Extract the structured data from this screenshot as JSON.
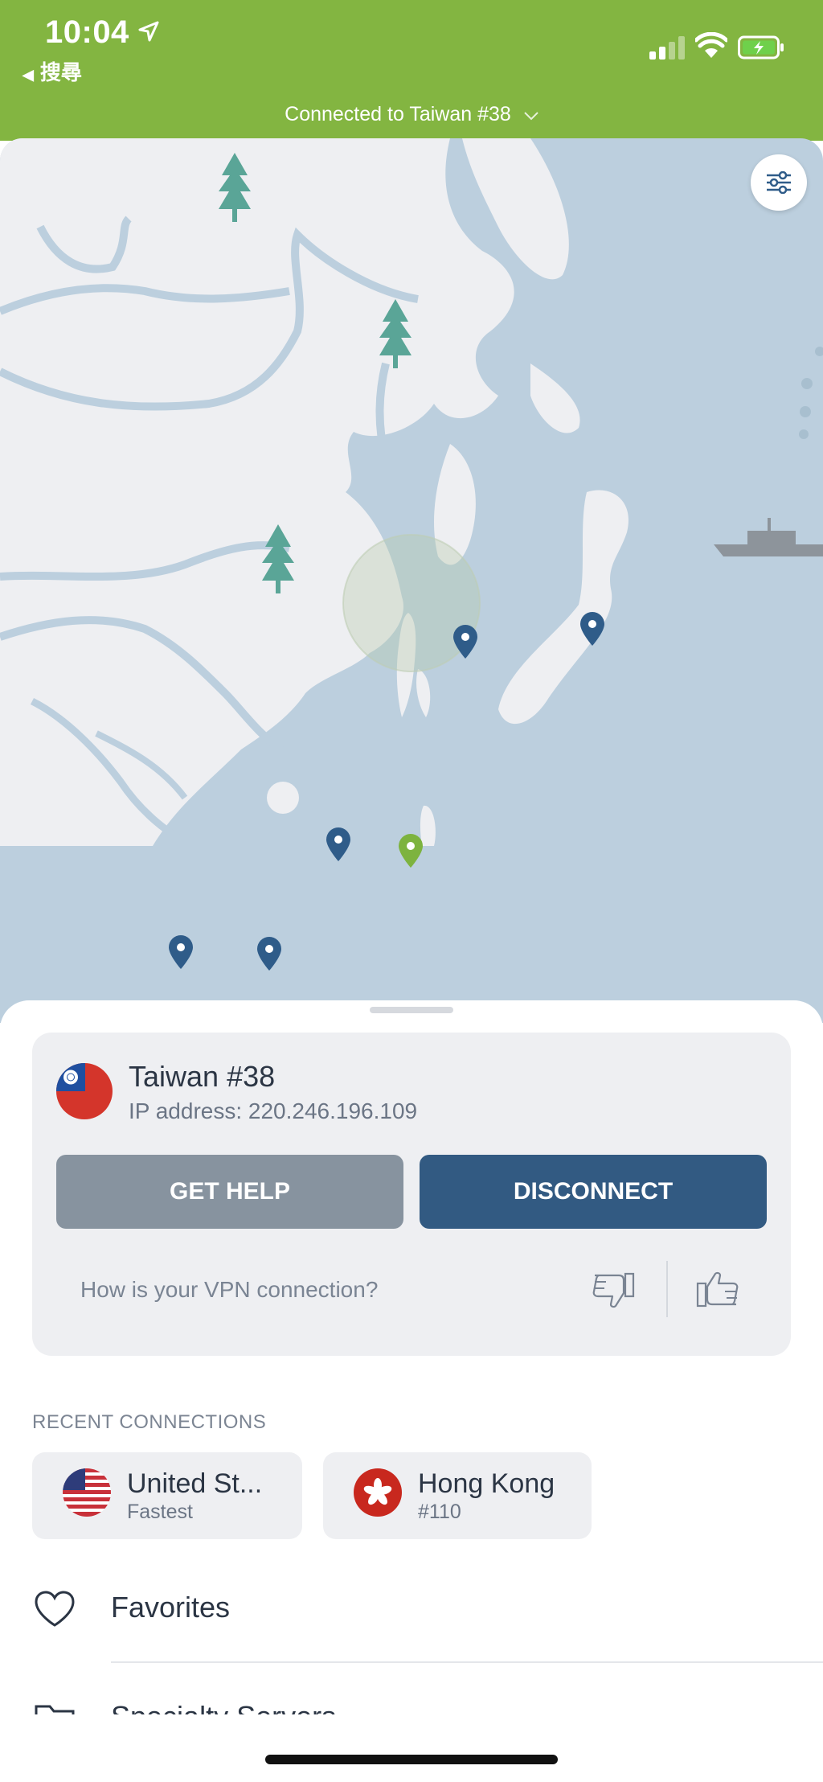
{
  "status_bar": {
    "time": "10:04",
    "back_label": "搜尋",
    "icons": [
      "location-arrow-icon",
      "signal-bars-icon",
      "wifi-icon",
      "battery-charging-icon"
    ]
  },
  "header": {
    "connection_title": "Connected to Taiwan #38",
    "chevron_icon": "chevron-down-icon"
  },
  "map": {
    "filter_icon": "sliders-icon",
    "pins": [
      "server-pin",
      "server-pin",
      "server-pin",
      "server-pin",
      "server-pin",
      "connected-server-pin"
    ]
  },
  "connection_card": {
    "server_name": "Taiwan #38",
    "ip_label": "IP address: 220.246.196.109",
    "get_help_label": "GET HELP",
    "disconnect_label": "DISCONNECT",
    "feedback_question": "How is your VPN connection?"
  },
  "recent": {
    "section_label": "RECENT CONNECTIONS",
    "items": [
      {
        "title": "United St...",
        "subtitle": "Fastest"
      },
      {
        "title": "Hong Kong",
        "subtitle": "#110"
      }
    ]
  },
  "menu": {
    "items": [
      {
        "label": "Favorites",
        "icon": "heart-icon"
      },
      {
        "label": "Specialty Servers",
        "icon": "folder-icon"
      }
    ]
  },
  "colors": {
    "header_green": "#83b541",
    "sea": "#bccfde",
    "land": "#eeeff2",
    "pin_blue": "#2f5c89",
    "pin_green": "#7db33f",
    "disconnect_blue": "#325a82",
    "help_gray": "#87939f"
  }
}
